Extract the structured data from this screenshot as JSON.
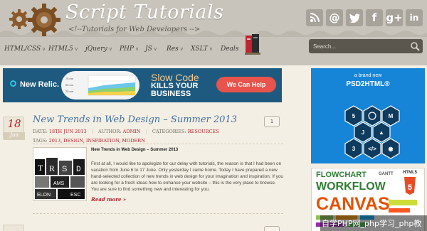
{
  "site": {
    "title": "Script Tutorials",
    "tagline": "<!--Tutorials for Web Developers -->"
  },
  "social": [
    {
      "name": "rss",
      "icon": "rss-icon"
    },
    {
      "name": "email",
      "icon": "at-icon",
      "glyph": "@"
    },
    {
      "name": "twitter",
      "icon": "twitter-icon"
    },
    {
      "name": "facebook",
      "icon": "facebook-icon",
      "glyph": "f"
    },
    {
      "name": "google-plus",
      "icon": "google-plus-icon",
      "glyph": "g+"
    },
    {
      "name": "linkedin",
      "icon": "linkedin-icon",
      "glyph": "in"
    }
  ],
  "nav": {
    "items": [
      "HTML/CSS",
      "HTML5",
      "jQuery",
      "PHP",
      "JS",
      "Res",
      "XSLT",
      "Deals"
    ]
  },
  "search": {
    "placeholder": "Search..."
  },
  "banner": {
    "brand": "New Relic.",
    "gauge_labels": [
      "75 ms",
      "50 ms",
      "25 ms"
    ],
    "headline": "Slow Code",
    "tagline_line1": "KILLS YOUR",
    "tagline_line2": "BUSINESS",
    "cta": "We Can Help"
  },
  "post": {
    "day": "18",
    "month": "Jun",
    "title": "New Trends in Web Design – Summer 2013",
    "comments": "1",
    "date_label": "DATE:",
    "date": "18TH JUN 2013",
    "author_label": "AUTHOR:",
    "author": "ADMIN",
    "categories_label": "CATEGORIES:",
    "categories": "RESOURCES",
    "tags_label": "TAGS:",
    "tags": "2013, DESIGN, INSPIRATION, MODERN",
    "thumb_title": "New Trends in Web Design – Summer 2013",
    "excerpt": "First at all, I would like to apologize for our delay with tutorials, the reason is that I had been on vacation from June 6 to 17 June. Only yesterday I came home. Today I have prepared a new hand-selected collection of new trends in web design for your imagination and inspiration. If you are looking for a fresh ideas how to enhance your website – this is the very place to browse. You are sure to find something new and interesting for you.",
    "read_more": "Read more »"
  },
  "ads": {
    "p2h": {
      "line1": "a brand new",
      "line2": "PSD2HTML®"
    },
    "fw": {
      "words": [
        "FLOWCHART",
        "WORKFLOW",
        "CANVAS",
        "HTML5",
        "GANTT"
      ]
    }
  },
  "footer": {
    "watermark": "自学PHP网_php学习_php教"
  },
  "colors": {
    "header_bg": "#c9c4bb",
    "page_bg": "#f4efe4",
    "accent_red": "#b5222e",
    "link_blue": "#3f6f9e",
    "banner_bg": "#1e5a80",
    "p2h_blue": "#1685d8"
  }
}
